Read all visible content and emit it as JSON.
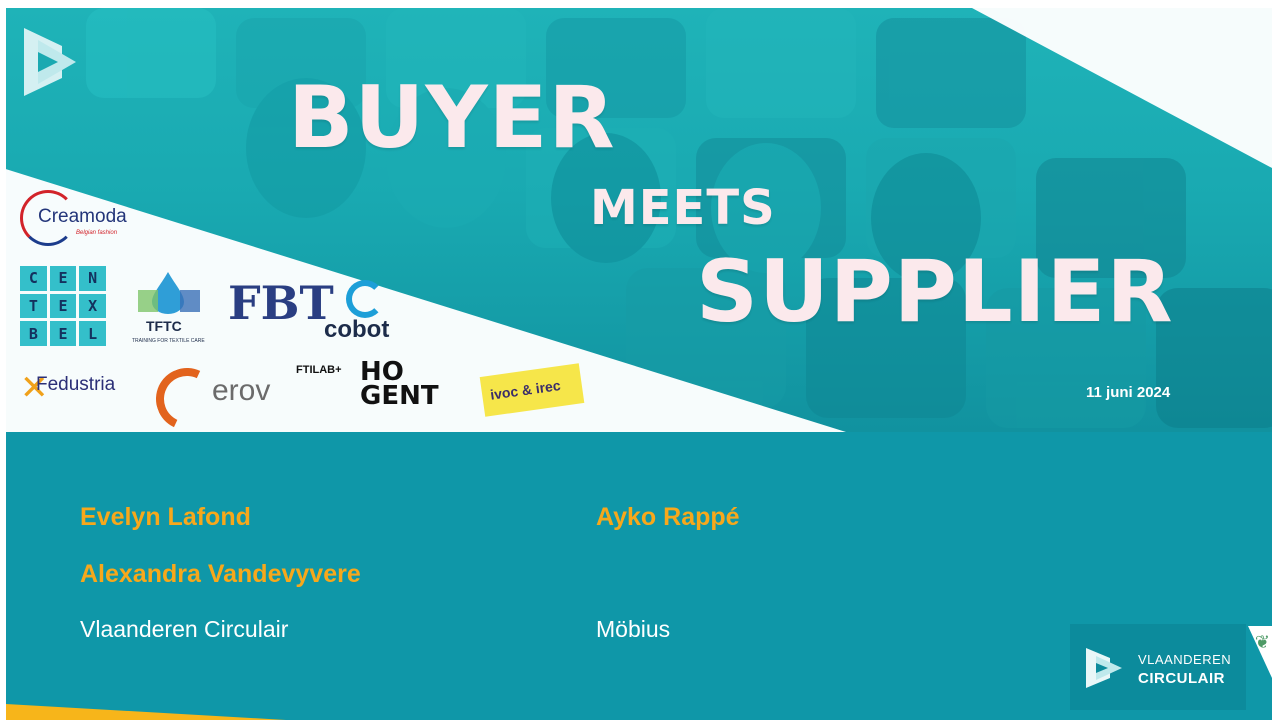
{
  "banner": {
    "headline": {
      "line1": "BUYER",
      "line2": "MEETS",
      "line3": "SUPPLIER"
    },
    "date": "11 juni 2024",
    "partner_logos": {
      "creamoda": {
        "name": "Creamoda",
        "tagline": "Belgian fashion"
      },
      "centexbel": {
        "letters": [
          "C",
          "E",
          "N",
          "T",
          "E",
          "X",
          "B",
          "E",
          "L"
        ]
      },
      "tftc": {
        "name": "TFTC",
        "tagline": "TRAINING FOR TEXTILE CARE"
      },
      "fbt": {
        "name": "FBT"
      },
      "cobot": {
        "name": "cobot"
      },
      "fedustria": {
        "name": "Fedustria"
      },
      "erov": {
        "name": "erov"
      },
      "ftilab": {
        "name": "FTILAB+"
      },
      "hogent": {
        "line1": "HO",
        "line2": "GENT"
      },
      "ivoc": {
        "name": "ivoc & irec"
      }
    }
  },
  "speakers": {
    "left": {
      "names": [
        "Evelyn Lafond",
        "Alexandra Vandevyvere"
      ],
      "organization": "Vlaanderen Circulair"
    },
    "right": {
      "names": [
        "Ayko Rappé"
      ],
      "organization": "Möbius"
    }
  },
  "footer": {
    "logo_line1": "VLAANDEREN",
    "logo_line2": "CIRCULAIR",
    "lion_icon": "flemish-lion-icon"
  },
  "colors": {
    "teal": "#0f97a8",
    "orange": "#f7a81b",
    "headline": "#fbe9ec"
  }
}
